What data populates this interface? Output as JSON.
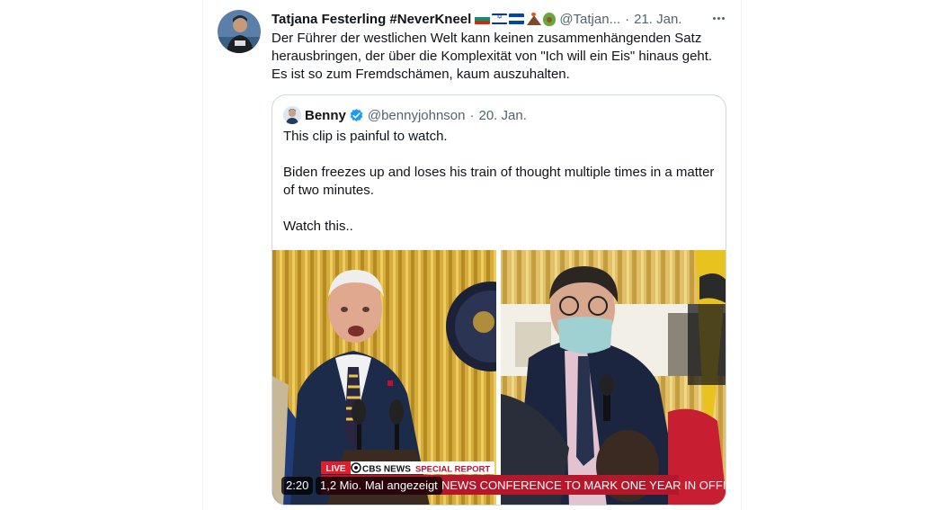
{
  "tweet": {
    "display_name": "Tatjana Festerling #NeverKneel",
    "emoji_names": [
      "bulgaria-flag-icon",
      "israel-flag-icon",
      "el-salvador-flag-icon",
      "volcano-icon",
      "avocado-icon"
    ],
    "handle": "@Tatjan...",
    "separator": "·",
    "date": "21. Jan.",
    "text_lines": [
      "Der Führer der westlichen Welt kann keinen zusammenhängenden Satz",
      "herausbringen, der über die Komplexität von \"Ich will ein Eis\" hinaus geht.",
      "Es ist so zum Fremdschämen, kaum auszuhalten."
    ]
  },
  "quote": {
    "display_name": "Benny",
    "verified": true,
    "handle": "@bennyjohnson",
    "separator": "·",
    "date": "20. Jan.",
    "paragraphs": [
      "This clip is painful to watch.",
      "Biden freezes up and loses his train of thought multiple times in a matter of two minutes.",
      "Watch this.."
    ],
    "media": {
      "live_label": "LIVE",
      "network_label": "CBS NEWS",
      "special_label": "SPECIAL REPORT",
      "ticker_text": "NEWS CONFERENCE TO MARK ONE YEAR IN OFFICE",
      "timer": "2:20",
      "views": "1,2 Mio. Mal angezeigt"
    }
  },
  "colors": {
    "text": "#0f1419",
    "secondary": "#536471",
    "border": "#cfd9de",
    "verified": "#1d9bf0",
    "cbs_red": "#c8102e"
  }
}
